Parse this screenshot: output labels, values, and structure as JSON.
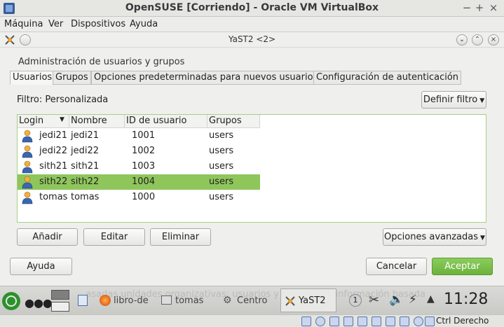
{
  "host": {
    "title": "OpenSUSE [Corriendo] - Oracle VM VirtualBox",
    "menu": [
      "Máquina",
      "Ver",
      "Dispositivos",
      "Ayuda"
    ],
    "controls": {
      "minimize": "−",
      "maximize": "+",
      "close": "×"
    }
  },
  "guest": {
    "title": "YaST2 <2>",
    "heading": "Administración de usuarios y grupos",
    "tabs": [
      "Usuarios",
      "Grupos",
      "Opciones predeterminadas para nuevos usuarios",
      "Configuración de autenticación"
    ],
    "filter_label": "Filtro: Personalizada",
    "define_filter": "Definir filtro",
    "table": {
      "columns": [
        "Login",
        "Nombre",
        "ID de usuario",
        "Grupos"
      ],
      "rows": [
        {
          "login": "jedi21",
          "name": "jedi21",
          "uid": "1001",
          "groups": "users"
        },
        {
          "login": "jedi22",
          "name": "jedi22",
          "uid": "1002",
          "groups": "users"
        },
        {
          "login": "sith21",
          "name": "sith21",
          "uid": "1003",
          "groups": "users"
        },
        {
          "login": "sith22",
          "name": "sith22",
          "uid": "1004",
          "groups": "users"
        },
        {
          "login": "tomas",
          "name": "tomas",
          "uid": "1000",
          "groups": "users"
        }
      ],
      "selected_row": 3
    },
    "buttons": {
      "add": "Añadir",
      "edit": "Editar",
      "delete": "Eliminar",
      "advanced": "Opciones avanzadas",
      "help": "Ayuda",
      "cancel": "Cancelar",
      "accept": "Aceptar"
    }
  },
  "taskbar": {
    "background_text": "...asadas unidades organizativas: usuarios y grupos con información basada",
    "tasks": [
      "libro-de",
      "tomas",
      "Centro",
      "YaST2"
    ],
    "badge": "1",
    "clock": "11:28"
  },
  "statusbar": {
    "hostkey": "Ctrl Derecho"
  },
  "colors": {
    "selection": "#8fc65c",
    "accept": "#6cb23b",
    "table_border": "#a7cf85"
  }
}
